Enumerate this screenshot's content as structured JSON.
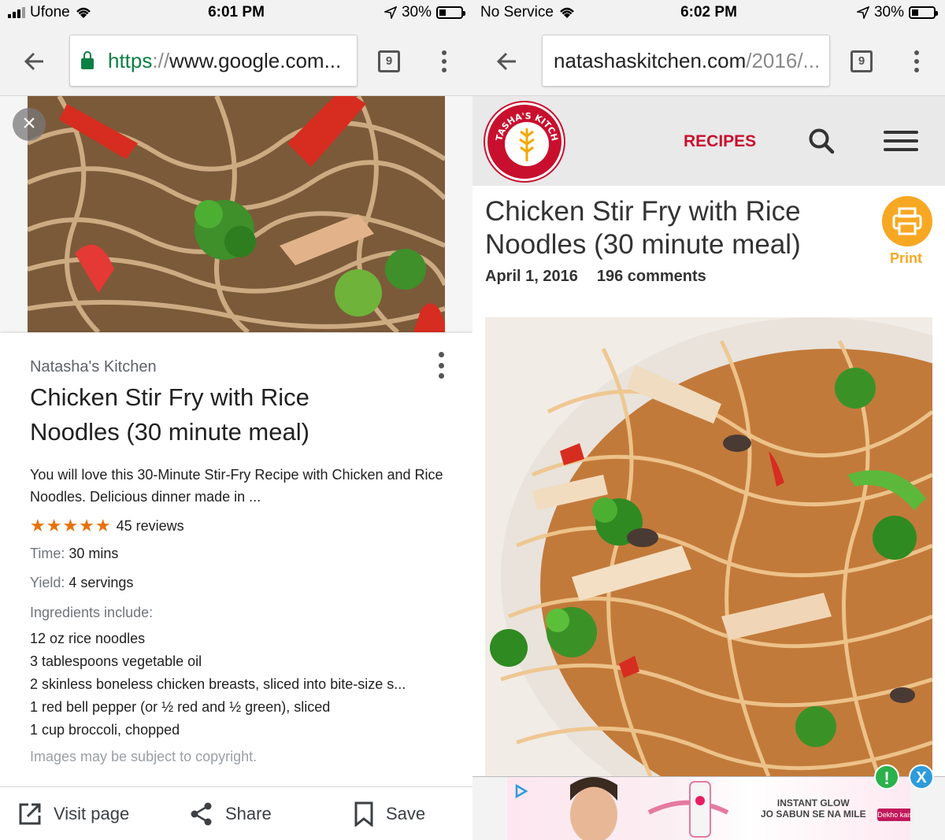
{
  "left": {
    "status": {
      "carrier": "Ufone",
      "time": "6:01 PM",
      "battery": "30%"
    },
    "toolbar": {
      "url_scheme": "https",
      "url_sep": "://",
      "url_host": "www.google.com...",
      "tabs_count": "9"
    },
    "card": {
      "source": "Natasha's Kitchen",
      "title": "Chicken Stir Fry with Rice Noodles (30 minute meal)",
      "description": "You will love this 30-Minute Stir-Fry Recipe with Chicken and Rice Noodles. Delicious dinner made in ...",
      "stars": "★★★★★",
      "rating_value": 5,
      "reviews": "45 reviews",
      "time_label": "Time:",
      "time_value": "30 mins",
      "yield_label": "Yield:",
      "yield_value": "4 servings",
      "ingredients_heading": "Ingredients include:",
      "ingredients": [
        "12 oz rice noodles",
        "3 tablespoons vegetable oil",
        "2 skinless boneless chicken breasts, sliced into bite-size s...",
        "1 red bell pepper (or ½ red and ½ green), sliced",
        "1 cup broccoli, chopped"
      ],
      "copyright": "Images may be subject to copyright."
    },
    "actions": {
      "visit": "Visit page",
      "share": "Share",
      "save": "Save"
    }
  },
  "right": {
    "status": {
      "carrier": "No Service",
      "time": "6:02 PM",
      "battery": "30%"
    },
    "toolbar": {
      "url_host": "natashaskitchen.com",
      "url_path": "/2016/...",
      "tabs_count": "9"
    },
    "site": {
      "logo_text": "NATASHA'S KITCHEN",
      "nav_recipes": "RECIPES"
    },
    "post": {
      "title": "Chicken Stir Fry with Rice Noodles (30 minute meal)",
      "print": "Print",
      "date": "April 1, 2016",
      "comments": "196 comments"
    },
    "ad": {
      "line1": "INSTANT GLOW",
      "line2": "JO SABUN SE NA MILE",
      "cta": "Dekho kaise naya",
      "info_icon": "!",
      "close_icon": "X"
    }
  },
  "colors": {
    "secure_green": "#0b8043",
    "brand_red": "#c8102e",
    "print_orange": "#f7a823",
    "star_orange": "#e8710a"
  }
}
